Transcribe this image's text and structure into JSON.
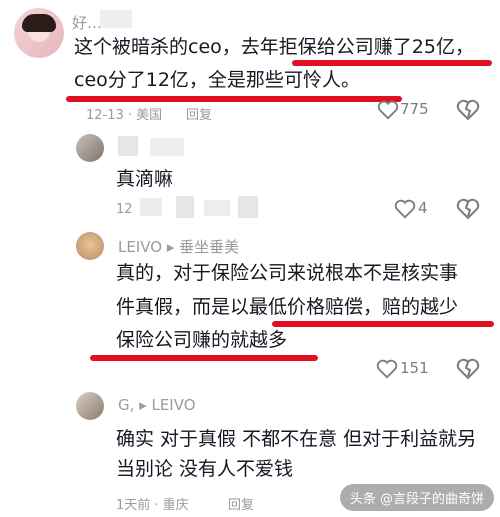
{
  "comments": [
    {
      "user": "好…",
      "lines": [
        "这个被暗杀的ceo，去年拒保给公司赚了25亿，",
        "ceo分了12亿，全是那些可怜人。"
      ],
      "meta": "12-13 · 美国",
      "reply": "回复",
      "likes": "775"
    },
    {
      "user": "",
      "lines": [
        "真滴嘛"
      ],
      "meta": "12",
      "reply": "",
      "likes": "4"
    },
    {
      "user": "LEIVO ▸ 垂坐垂美",
      "lines": [
        "真的，对于保险公司来说根本不是核实事",
        "件真假，而是以最低价格赔偿，赔的越少",
        "保险公司赚的就越多"
      ],
      "meta": "",
      "reply": "",
      "likes": "151"
    },
    {
      "user": "G, ▸ LEIVO",
      "lines": [
        "确实 对于真假 不都不在意 但对于利益就另",
        "当别论 没有人不爱钱"
      ],
      "meta": "1天前 · 重庆",
      "reply": "回复",
      "likes": ""
    }
  ],
  "watermark": "头条 @言段子的曲奇饼",
  "colors": {
    "highlight": "#e01020",
    "muted": "#9a9aa0"
  }
}
